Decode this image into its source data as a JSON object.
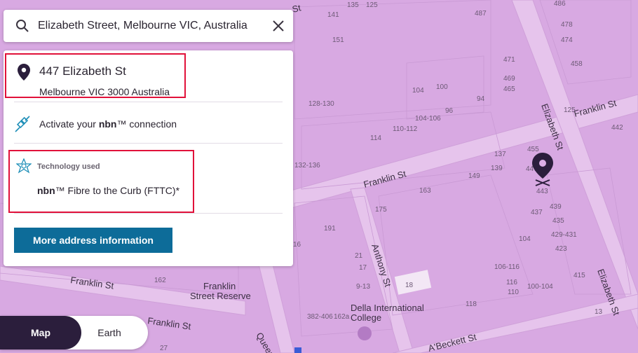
{
  "search": {
    "value": "Elizabeth Street, Melbourne VIC, Australia"
  },
  "result": {
    "title": "447 Elizabeth St",
    "subtitle": "Melbourne VIC 3000 Australia",
    "activate_prefix": "Activate your ",
    "activate_brand": "nbn",
    "activate_suffix": "™ connection",
    "tech_label": "Technology used",
    "tech_brand": "nbn",
    "tech_suffix": "™ Fibre to the Curb (FTTC)*",
    "more_button": "More address information"
  },
  "map_toggle": {
    "map": "Map",
    "earth": "Earth",
    "selected": "Map"
  },
  "map": {
    "streets": [
      "Franklin St",
      "Franklin St",
      "Franklin St",
      "Franklin St",
      "Elizabeth St",
      "Elizabeth St",
      "Anthony St",
      "A'Beckett St",
      "Queen",
      "St"
    ],
    "places": [
      "Franklin",
      "Street Reserve",
      "Della International",
      "College"
    ],
    "numbers": [
      "141",
      "135",
      "125",
      "487",
      "486",
      "151",
      "478",
      "474",
      "471",
      "458",
      "104",
      "100",
      "469",
      "465",
      "94",
      "128-130",
      "96",
      "125",
      "442",
      "104-106",
      "110-112",
      "114",
      "455",
      "137",
      "132-136",
      "149",
      "139",
      "163",
      "447",
      "443",
      "175",
      "439",
      "437",
      "435",
      "429-431",
      "191",
      "104",
      "423",
      "16",
      "21",
      "17",
      "106-116",
      "415",
      "9-13",
      "18",
      "116",
      "110",
      "100-104",
      "162",
      "382-406",
      "162a",
      "118",
      "27",
      "13"
    ],
    "marker_label": "443"
  },
  "colors": {
    "map_bg": "#dcaee6",
    "road": "#e8c8ee",
    "button": "#0d6c99",
    "highlight": "#e1113a",
    "toggle_active": "#2b1e3c"
  }
}
